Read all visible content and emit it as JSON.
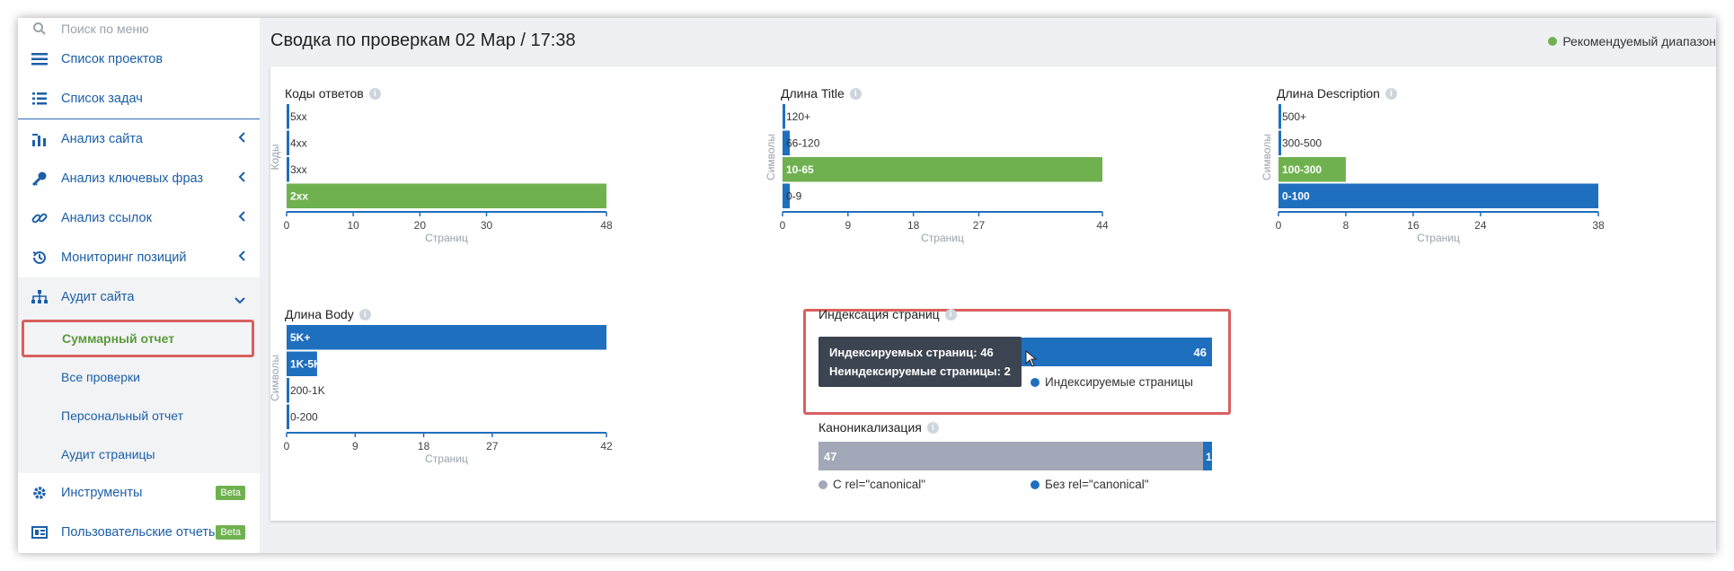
{
  "sidebar": {
    "search_placeholder": "Поиск по меню",
    "items": [
      {
        "label": "Список проектов",
        "icon": "list-icon"
      },
      {
        "label": "Список задач",
        "icon": "tasks-icon"
      },
      {
        "label": "Анализ сайта",
        "icon": "analytics-icon"
      },
      {
        "label": "Анализ ключевых фраз",
        "icon": "key-icon"
      },
      {
        "label": "Анализ ссылок",
        "icon": "link-icon"
      },
      {
        "label": "Мониторинг позиций",
        "icon": "history-icon"
      },
      {
        "label": "Аудит сайта",
        "icon": "sitemap-icon"
      }
    ],
    "audit_sub": [
      "Суммарный отчет",
      "Все проверки",
      "Персональный отчет",
      "Аудит страницы"
    ],
    "tools": {
      "label": "Инструменты",
      "badge": "Beta"
    },
    "user_reports": {
      "label": "Пользовательские отчеты",
      "badge": "Beta"
    }
  },
  "header": {
    "title": "Сводка по проверкам 02 Мар / 17:38",
    "legend": "Рекомендуемый диапазон",
    "legend_color": "#6fb14f"
  },
  "colors": {
    "blue": "#1f6fbf",
    "green": "#6fb14f",
    "gray": "#a3a8b8"
  },
  "chart_data": [
    {
      "type": "bar",
      "title": "Коды ответов",
      "ylabel": "Коды",
      "xlabel": "Страниц",
      "categories": [
        "5xx",
        "4xx",
        "3xx",
        "2xx"
      ],
      "values": [
        0,
        0,
        0,
        48
      ],
      "highlight": [
        false,
        false,
        false,
        true
      ],
      "ticks": [
        "0",
        "10",
        "20",
        "30",
        "48"
      ],
      "xlim": [
        0,
        48
      ]
    },
    {
      "type": "bar",
      "title": "Длина Title",
      "ylabel": "Символы",
      "xlabel": "Страниц",
      "categories": [
        "120+",
        "66-120",
        "10-65",
        "0-9"
      ],
      "values": [
        0,
        1,
        44,
        1
      ],
      "highlight": [
        false,
        false,
        true,
        false
      ],
      "ticks": [
        "0",
        "9",
        "18",
        "27",
        "44"
      ],
      "xlim": [
        0,
        44
      ]
    },
    {
      "type": "bar",
      "title": "Длина Description",
      "ylabel": "Символы",
      "xlabel": "Страниц",
      "categories": [
        "500+",
        "300-500",
        "100-300",
        "0-100"
      ],
      "values": [
        0,
        0,
        8,
        38
      ],
      "highlight": [
        false,
        false,
        true,
        false
      ],
      "ticks": [
        "0",
        "8",
        "16",
        "24",
        "38"
      ],
      "xlim": [
        0,
        38
      ]
    },
    {
      "type": "bar",
      "title": "Длина Body",
      "ylabel": "Символы",
      "xlabel": "Страниц",
      "categories": [
        "5K+",
        "1K-5K",
        "200-1K",
        "0-200"
      ],
      "values": [
        42,
        4,
        0,
        0
      ],
      "highlight": [
        false,
        false,
        false,
        false
      ],
      "ticks": [
        "0",
        "9",
        "18",
        "27",
        "42"
      ],
      "xlim": [
        0,
        42
      ]
    },
    {
      "type": "stacked-bar",
      "title": "Индексация страниц",
      "segments": [
        {
          "name": "Индексируемые страницы",
          "value": 46,
          "color": "#1f6fbf"
        },
        {
          "name": "Неиндексируемые страницы",
          "value": 2,
          "color": "#a3a8b8"
        }
      ],
      "bar_label": "46",
      "tooltip": [
        "Индексируемых страниц: 46",
        "Неиндексируемые страницы: 2"
      ],
      "legend": "Индексируемые страницы"
    },
    {
      "type": "stacked-bar",
      "title": "Каноникализация",
      "segments": [
        {
          "name": "С rel=\"canonical\"",
          "value": 47,
          "color": "#a3a8b8"
        },
        {
          "name": "Без rel=\"canonical\"",
          "value": 1,
          "color": "#1f6fbf"
        }
      ],
      "labels": [
        "47",
        "1"
      ],
      "legend": [
        "С rel=\"canonical\"",
        "Без rel=\"canonical\""
      ]
    }
  ]
}
